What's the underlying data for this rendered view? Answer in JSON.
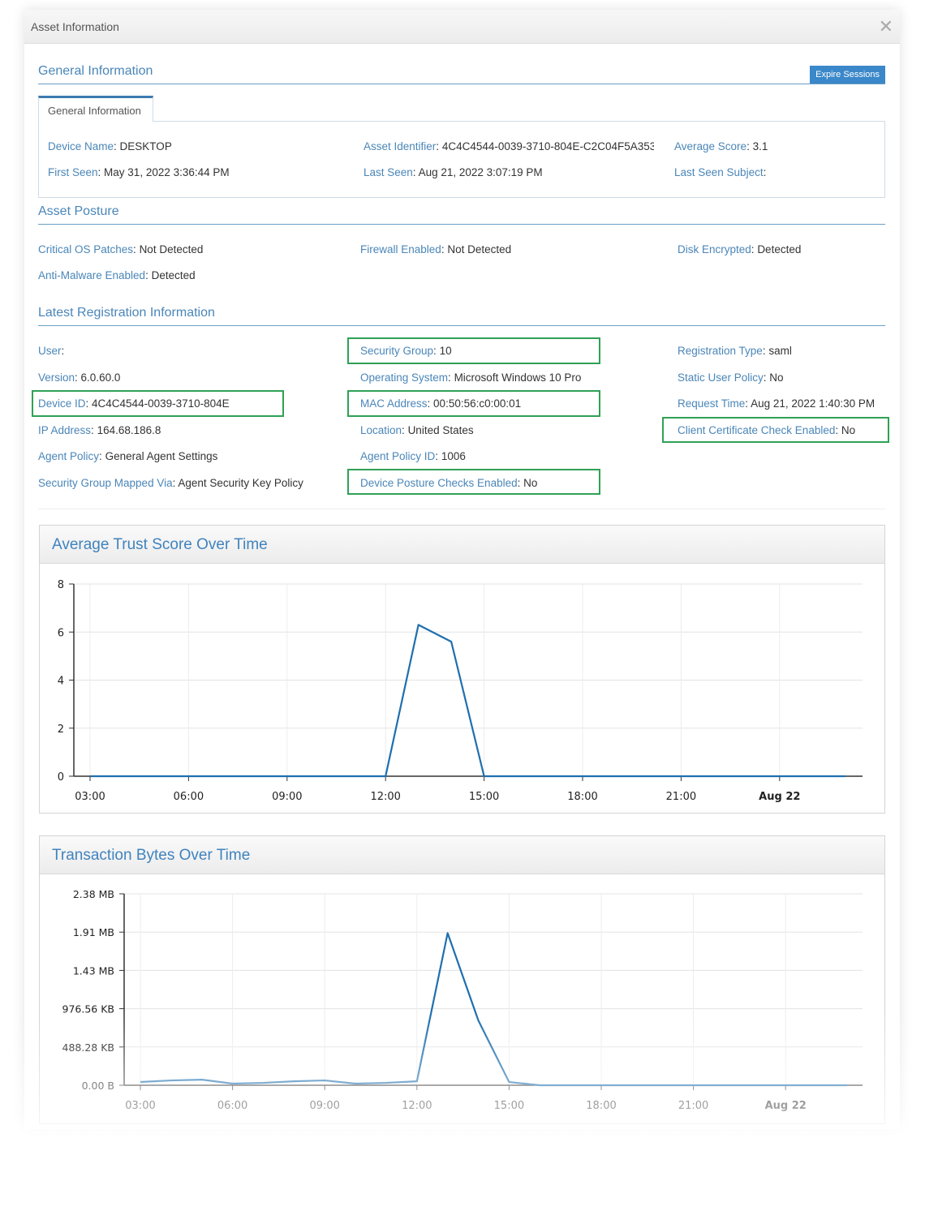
{
  "modal": {
    "title": "Asset Information",
    "close_icon": "close-icon"
  },
  "general": {
    "section_title": "General Information",
    "expire_button": "Expire Sessions",
    "tab_label": "General Information",
    "fields": [
      {
        "label": "Device Name",
        "value": "DESKTOP"
      },
      {
        "label": "Asset Identifier",
        "value": "4C4C4544-0039-3710-804E-C2C04F5A353"
      },
      {
        "label": "Average Score",
        "value": "3.1"
      },
      {
        "label": "First Seen",
        "value": "May 31, 2022 3:36:44 PM"
      },
      {
        "label": "Last Seen",
        "value": "Aug 21, 2022 3:07:19 PM"
      },
      {
        "label": "Last Seen Subject",
        "value": ""
      }
    ]
  },
  "posture": {
    "section_title": "Asset Posture",
    "fields": [
      {
        "label": "Critical OS Patches",
        "value": "Not Detected"
      },
      {
        "label": "Firewall Enabled",
        "value": "Not Detected"
      },
      {
        "label": "Disk Encrypted",
        "value": "Detected"
      },
      {
        "label": "Anti-Malware Enabled",
        "value": "Detected"
      }
    ]
  },
  "registration": {
    "section_title": "Latest Registration Information",
    "fields": [
      {
        "label": "User",
        "value": "",
        "highlighted": false
      },
      {
        "label": "Security Group",
        "value": "10",
        "highlighted": true
      },
      {
        "label": "Registration Type",
        "value": "saml",
        "highlighted": false
      },
      {
        "label": "Version",
        "value": "6.0.60.0",
        "highlighted": false
      },
      {
        "label": "Operating System",
        "value": "Microsoft Windows 10 Pro",
        "highlighted": false
      },
      {
        "label": "Static User Policy",
        "value": "No",
        "highlighted": false
      },
      {
        "label": "Device ID",
        "value": "4C4C4544-0039-3710-804E",
        "highlighted": true
      },
      {
        "label": "MAC Address",
        "value": "00:50:56:c0:00:01",
        "highlighted": true
      },
      {
        "label": "Request Time",
        "value": "Aug 21, 2022 1:40:30 PM",
        "highlighted": false
      },
      {
        "label": "IP Address",
        "value": "164.68.186.8",
        "highlighted": false
      },
      {
        "label": "Location",
        "value": "United States",
        "highlighted": false
      },
      {
        "label": "Client Certificate Check Enabled",
        "value": "No",
        "highlighted": true
      },
      {
        "label": "Agent Policy",
        "value": "General Agent Settings",
        "highlighted": false
      },
      {
        "label": "Agent Policy ID",
        "value": "1006",
        "highlighted": false
      },
      {
        "label": "Security Group Mapped Via",
        "value": "Agent Security Key Policy",
        "highlighted": false
      },
      {
        "label": "Device Posture Checks Enabled",
        "value": "No",
        "highlighted": true
      }
    ]
  },
  "colors": {
    "accent": "#3a87c9",
    "label": "#4a86b8",
    "highlight": "#2fa155",
    "series": "#1f6fae"
  },
  "chart_data": [
    {
      "type": "line",
      "title": "Average Trust Score Over Time",
      "xlabel": "",
      "ylabel": "",
      "x_tick_labels": [
        "03:00",
        "06:00",
        "09:00",
        "12:00",
        "15:00",
        "18:00",
        "21:00",
        "Aug 22"
      ],
      "x_tick_bold": [
        false,
        false,
        false,
        false,
        false,
        false,
        false,
        true
      ],
      "x_hours_start": 3,
      "x_hours_end": 27,
      "y_ticks": [
        0,
        2,
        4,
        6,
        8
      ],
      "y_tick_labels": [
        "0",
        "2",
        "4",
        "6",
        "8"
      ],
      "ylim": [
        0,
        8
      ],
      "grid": true,
      "series": [
        {
          "name": "Average Trust Score",
          "x_hours": [
            3,
            4,
            5,
            6,
            7,
            8,
            9,
            10,
            11,
            12,
            13,
            14,
            15,
            16,
            17,
            18,
            19,
            20,
            21,
            22,
            23,
            24,
            25,
            26
          ],
          "values": [
            0,
            0,
            0,
            0,
            0,
            0,
            0,
            0,
            0,
            0,
            6.3,
            5.6,
            0,
            0,
            0,
            0,
            0,
            0,
            0,
            0,
            0,
            0,
            0,
            0
          ]
        }
      ]
    },
    {
      "type": "line",
      "title": "Transaction Bytes Over Time",
      "xlabel": "",
      "ylabel": "",
      "x_tick_labels": [
        "03:00",
        "06:00",
        "09:00",
        "12:00",
        "15:00",
        "18:00",
        "21:00",
        "Aug 22"
      ],
      "x_tick_bold": [
        false,
        false,
        false,
        false,
        false,
        false,
        false,
        true
      ],
      "x_hours_start": 3,
      "x_hours_end": 27,
      "y_ticks": [
        0,
        500000,
        1000000,
        1500000,
        2000000,
        2500000
      ],
      "y_tick_labels": [
        "0.00 B",
        "488.28 KB",
        "976.56 KB",
        "1.43 MB",
        "1.91 MB",
        "2.38 MB"
      ],
      "ylim": [
        0,
        2500000
      ],
      "y_unit": "bytes",
      "grid": true,
      "series": [
        {
          "name": "Transaction Bytes",
          "x_hours": [
            3,
            4,
            5,
            6,
            7,
            8,
            9,
            10,
            11,
            12,
            13,
            14,
            15,
            16,
            17,
            18,
            19,
            20,
            21,
            22,
            23,
            24,
            25,
            26
          ],
          "values": [
            42000,
            63000,
            73000,
            21000,
            31000,
            52000,
            63000,
            21000,
            31000,
            52000,
            1987000,
            846000,
            42000,
            0,
            0,
            0,
            0,
            0,
            0,
            0,
            0,
            0,
            0,
            0
          ]
        }
      ]
    }
  ]
}
